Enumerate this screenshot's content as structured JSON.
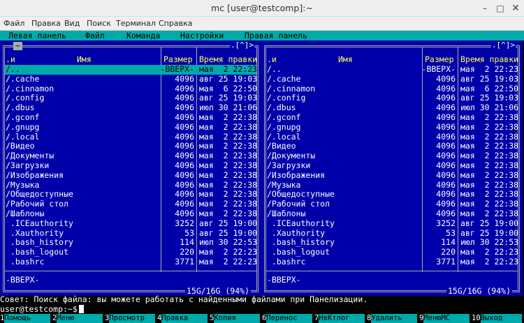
{
  "window": {
    "title": "mc [user@testcomp]:~",
    "min": "–",
    "max": "□",
    "close": "✕"
  },
  "menu": [
    "Файл",
    "Правка",
    "Вид",
    "Поиск",
    "Терминал",
    "Справка"
  ],
  "mc_menu": [
    "Левая панель",
    "Файл",
    "Команда",
    "Настройки",
    "Правая панель"
  ],
  "panels": {
    "left": {
      "path": "~",
      "corner": ".[^]>",
      "headers": {
        "sort": ".и",
        "name": "Имя",
        "size": "Размер",
        "mtime": "Время правки"
      },
      "status": "-BBEPX-",
      "disk": "15G/16G (94%)"
    },
    "right": {
      "path": "",
      "corner": ".[^]>",
      "headers": {
        "sort": ".и",
        "name": "Имя",
        "size": "Размер",
        "mtime": "Время правки"
      },
      "status": "-BBEPX-",
      "disk": "15G/16G (94%)"
    }
  },
  "left_files": [
    {
      "name": "/..",
      "size": "-BBEPX-",
      "mtime": "мая  2 22:23",
      "selected": true
    },
    {
      "name": "/.cache",
      "size": "4096",
      "mtime": "авг 25 19:03"
    },
    {
      "name": "/.cinnamon",
      "size": "4096",
      "mtime": "мая  6 22:50"
    },
    {
      "name": "/.config",
      "size": "4096",
      "mtime": "авг 25 19:03"
    },
    {
      "name": "/.dbus",
      "size": "4096",
      "mtime": "июл 30 21:06"
    },
    {
      "name": "/.gconf",
      "size": "4096",
      "mtime": "мая  2 22:38"
    },
    {
      "name": "/.gnupg",
      "size": "4096",
      "mtime": "мая  2 22:38"
    },
    {
      "name": "/.local",
      "size": "4096",
      "mtime": "мая  2 22:38"
    },
    {
      "name": "/Видео",
      "size": "4096",
      "mtime": "мая  2 22:38"
    },
    {
      "name": "/Документы",
      "size": "4096",
      "mtime": "мая  2 22:38"
    },
    {
      "name": "/Загрузки",
      "size": "4096",
      "mtime": "мая  2 22:38"
    },
    {
      "name": "/Изображения",
      "size": "4096",
      "mtime": "мая  2 22:38"
    },
    {
      "name": "/Музыка",
      "size": "4096",
      "mtime": "мая  2 22:38"
    },
    {
      "name": "/Общедоступные",
      "size": "4096",
      "mtime": "мая  2 22:38"
    },
    {
      "name": "/Рабочий стол",
      "size": "4096",
      "mtime": "мая  2 22:38"
    },
    {
      "name": "/Шаблоны",
      "size": "4096",
      "mtime": "мая  2 22:38"
    },
    {
      "name": " .ICEauthority",
      "size": "3252",
      "mtime": "авг 25 19:00"
    },
    {
      "name": " .Xauthority",
      "size": "53",
      "mtime": "авг 25 19:00"
    },
    {
      "name": " .bash_history",
      "size": "114",
      "mtime": "июл 30 22:53"
    },
    {
      "name": " .bash_logout",
      "size": "220",
      "mtime": "мая  2 22:23"
    },
    {
      "name": " .bashrc",
      "size": "3771",
      "mtime": "мая  2 22:23"
    }
  ],
  "right_files": [
    {
      "name": "/..",
      "size": "-BBEPX-",
      "mtime": "мая  2 22:23"
    },
    {
      "name": "/.cache",
      "size": "4096",
      "mtime": "авг 25 19:03"
    },
    {
      "name": "/.cinnamon",
      "size": "4096",
      "mtime": "мая  6 22:50"
    },
    {
      "name": "/.config",
      "size": "4096",
      "mtime": "авг 25 19:03"
    },
    {
      "name": "/.dbus",
      "size": "4096",
      "mtime": "июл 30 21:06"
    },
    {
      "name": "/.gconf",
      "size": "4096",
      "mtime": "мая  2 22:38"
    },
    {
      "name": "/.gnupg",
      "size": "4096",
      "mtime": "мая  2 22:38"
    },
    {
      "name": "/.local",
      "size": "4096",
      "mtime": "мая  2 22:38"
    },
    {
      "name": "/Видео",
      "size": "4096",
      "mtime": "мая  2 22:38"
    },
    {
      "name": "/Документы",
      "size": "4096",
      "mtime": "мая  2 22:38"
    },
    {
      "name": "/Загрузки",
      "size": "4096",
      "mtime": "мая  2 22:38"
    },
    {
      "name": "/Изображения",
      "size": "4096",
      "mtime": "мая  2 22:38"
    },
    {
      "name": "/Музыка",
      "size": "4096",
      "mtime": "мая  2 22:38"
    },
    {
      "name": "/Общедоступные",
      "size": "4096",
      "mtime": "мая  2 22:38"
    },
    {
      "name": "/Рабочий стол",
      "size": "4096",
      "mtime": "мая  2 22:38"
    },
    {
      "name": "/Шаблоны",
      "size": "4096",
      "mtime": "мая  2 22:38"
    },
    {
      "name": " .ICEauthority",
      "size": "3252",
      "mtime": "авг 25 19:00"
    },
    {
      "name": " .Xauthority",
      "size": "53",
      "mtime": "авг 25 19:00"
    },
    {
      "name": " .bash_history",
      "size": "114",
      "mtime": "июл 30 22:53"
    },
    {
      "name": " .bash_logout",
      "size": "220",
      "mtime": "мая  2 22:23"
    },
    {
      "name": " .bashrc",
      "size": "3771",
      "mtime": "мая  2 22:23"
    }
  ],
  "hint": "Совет: Поиск файла: вы можете работать с найденными файлами при Панелизации.",
  "prompt": "user@testcomp:~$",
  "fkeys": [
    {
      "num": "1",
      "label": "Помощь"
    },
    {
      "num": "2",
      "label": "Меню"
    },
    {
      "num": "3",
      "label": "Просмотр"
    },
    {
      "num": "4",
      "label": "Правка"
    },
    {
      "num": "5",
      "label": "Копия"
    },
    {
      "num": "6",
      "label": "Перенос"
    },
    {
      "num": "7",
      "label": "НвКтлог"
    },
    {
      "num": "8",
      "label": "Удалить"
    },
    {
      "num": "9",
      "label": "МенюМС"
    },
    {
      "num": "10",
      "label": "Выход"
    }
  ],
  "colors": {
    "panel_bg": "#0000aa",
    "cyan": "#00aaaa",
    "header_yellow": "#ffff55"
  }
}
